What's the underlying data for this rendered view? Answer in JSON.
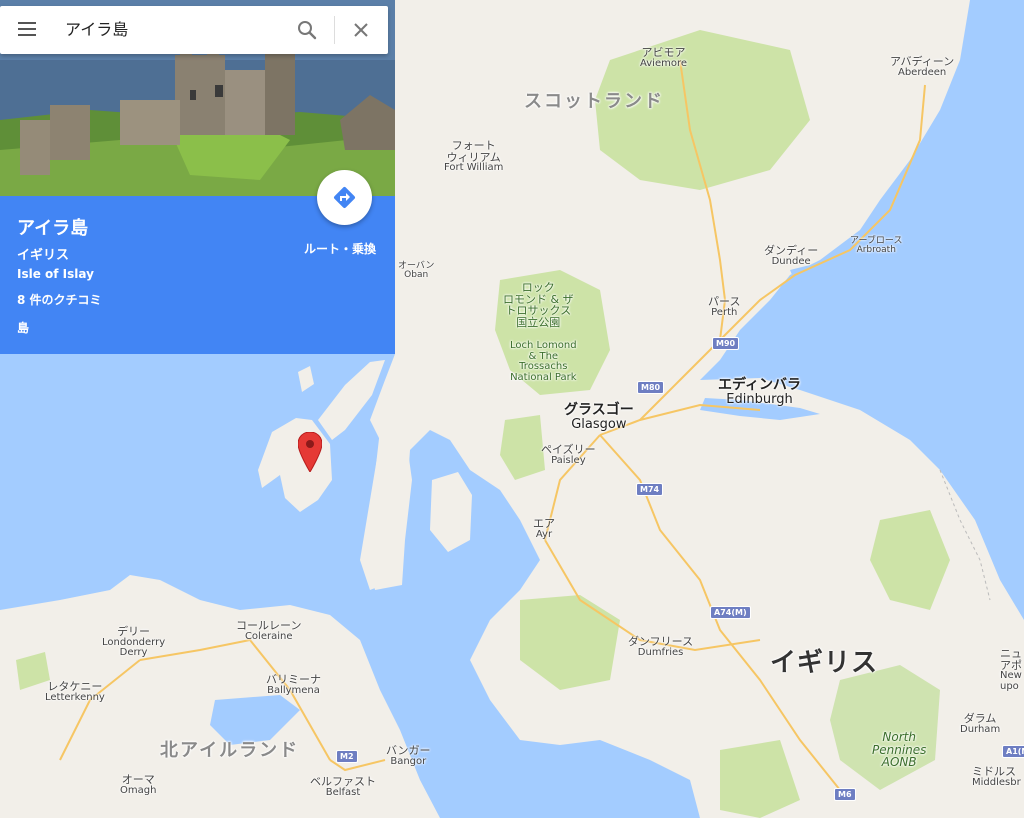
{
  "search": {
    "query": "アイラ島"
  },
  "place": {
    "title": "アイラ島",
    "country": "イギリス",
    "english_name": "Isle of Islay",
    "reviews": "8 件のクチコミ",
    "type": "島",
    "directions_label": "ルート・乗換"
  },
  "map": {
    "regions": {
      "scotland": "スコットランド",
      "northern_ireland": "北アイルランド",
      "uk": "イギリス"
    },
    "cities": {
      "aviemore": {
        "ja": "アビモア",
        "en": "Aviemore"
      },
      "aberdeen": {
        "ja": "アバディーン",
        "en": "Aberdeen"
      },
      "fort_william": {
        "ja": "フォート\nウィリアム",
        "en": "Fort William"
      },
      "dundee": {
        "ja": "ダンディー",
        "en": "Dundee"
      },
      "arbroath": {
        "ja": "アーブロース",
        "en": "Arbroath"
      },
      "oban": {
        "ja": "オーバン",
        "en": "Oban"
      },
      "perth": {
        "ja": "パース",
        "en": "Perth"
      },
      "edinburgh": {
        "ja": "エディンバラ",
        "en": "Edinburgh"
      },
      "glasgow": {
        "ja": "グラスゴー",
        "en": "Glasgow"
      },
      "paisley": {
        "ja": "ペイズリー",
        "en": "Paisley"
      },
      "ayr": {
        "ja": "エア",
        "en": "Ayr"
      },
      "dumfries": {
        "ja": "ダンフリース",
        "en": "Dumfries"
      },
      "derry": {
        "ja": "デリー",
        "en": "Londonderry\nDerry"
      },
      "coleraine": {
        "ja": "コールレーン",
        "en": "Coleraine"
      },
      "ballymena": {
        "ja": "バリミーナ",
        "en": "Ballymena"
      },
      "letterkenny": {
        "ja": "レタケニー",
        "en": "Letterkenny"
      },
      "omagh": {
        "ja": "オーマ",
        "en": "Omagh"
      },
      "belfast": {
        "ja": "ベルファスト",
        "en": "Belfast"
      },
      "bangor": {
        "ja": "バンガー",
        "en": "Bangor"
      },
      "durham": {
        "ja": "ダラム",
        "en": "Durham"
      },
      "newcastle": {
        "ja": "ニュ\nアポ",
        "en": "New\nupo"
      },
      "middlesbrough": {
        "ja": "ミドルス",
        "en": "Middlesbr"
      }
    },
    "parks": {
      "loch_lomond_ja": "ロック\nロモンド & ザ\nトロサックス\n国立公園",
      "loch_lomond_en": "Loch Lomond\n& The\nTrossachs\nNational Park",
      "north_pennines": "North\nPennines\nAONB"
    },
    "roads": [
      "M90",
      "M80",
      "M74",
      "A74(M)",
      "M2",
      "M6",
      "A1(M)"
    ]
  },
  "colors": {
    "water": "#a3ccff",
    "land": "#f2efe9",
    "park": "#cde3a7",
    "accent": "#4285f4",
    "pin": "#e53935"
  }
}
